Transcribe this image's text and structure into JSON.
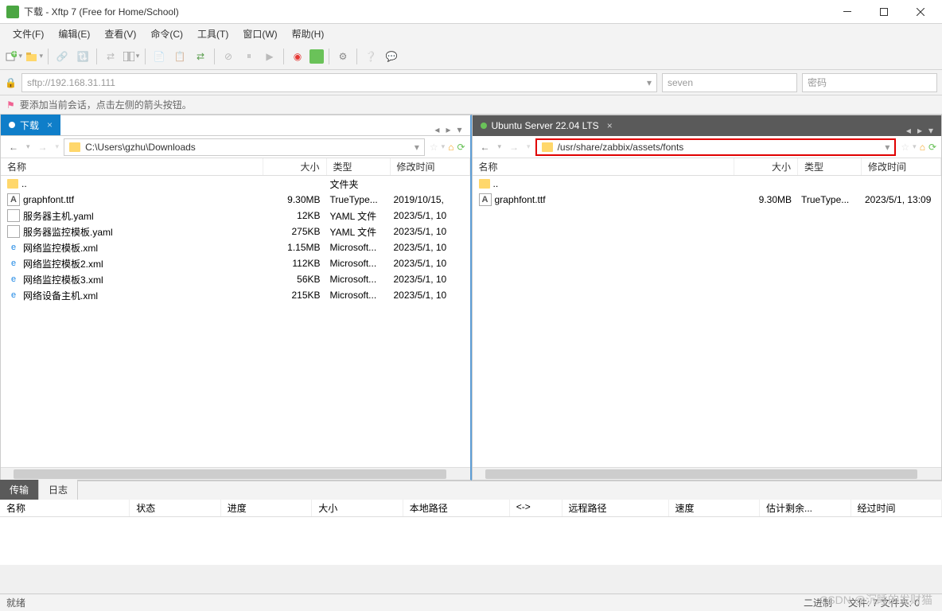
{
  "window": {
    "title": "下载 - Xftp 7 (Free for Home/School)"
  },
  "menu": {
    "file": "文件(F)",
    "edit": "编辑(E)",
    "view": "查看(V)",
    "cmd": "命令(C)",
    "tools": "工具(T)",
    "window": "窗口(W)",
    "help": "帮助(H)"
  },
  "address": {
    "url": "sftp://192.168.31.111",
    "user_ph": "seven",
    "pass_ph": "密码"
  },
  "hint": "要添加当前会话，点击左侧的箭头按钮。",
  "left": {
    "tab": "下载",
    "path": "C:\\Users\\gzhu\\Downloads",
    "cols": {
      "name": "名称",
      "size": "大小",
      "type": "类型",
      "date": "修改时间"
    },
    "parent": {
      "name": "..",
      "type": "文件夹"
    },
    "files": [
      {
        "ico": "font",
        "name": "graphfont.ttf",
        "size": "9.30MB",
        "type": "TrueType...",
        "date": "2019/10/15,"
      },
      {
        "ico": "yaml",
        "name": "服务器主机.yaml",
        "size": "12KB",
        "type": "YAML 文件",
        "date": "2023/5/1, 10"
      },
      {
        "ico": "yaml",
        "name": "服务器监控模板.yaml",
        "size": "275KB",
        "type": "YAML 文件",
        "date": "2023/5/1, 10"
      },
      {
        "ico": "xml",
        "name": "网络监控模板.xml",
        "size": "1.15MB",
        "type": "Microsoft...",
        "date": "2023/5/1, 10"
      },
      {
        "ico": "xml",
        "name": "网络监控模板2.xml",
        "size": "112KB",
        "type": "Microsoft...",
        "date": "2023/5/1, 10"
      },
      {
        "ico": "xml",
        "name": "网络监控模板3.xml",
        "size": "56KB",
        "type": "Microsoft...",
        "date": "2023/5/1, 10"
      },
      {
        "ico": "xml",
        "name": "网络设备主机.xml",
        "size": "215KB",
        "type": "Microsoft...",
        "date": "2023/5/1, 10"
      }
    ]
  },
  "right": {
    "tab": "Ubuntu Server 22.04 LTS",
    "path": "/usr/share/zabbix/assets/fonts",
    "cols": {
      "name": "名称",
      "size": "大小",
      "type": "类型",
      "date": "修改时间"
    },
    "parent": {
      "name": ".."
    },
    "files": [
      {
        "ico": "font",
        "name": "graphfont.ttf",
        "size": "9.30MB",
        "type": "TrueType...",
        "date": "2023/5/1, 13:09"
      }
    ]
  },
  "transfer": {
    "tab1": "传输",
    "tab2": "日志",
    "cols": {
      "name": "名称",
      "status": "状态",
      "progress": "进度",
      "size": "大小",
      "local": "本地路径",
      "dir": "<->",
      "remote": "远程路径",
      "speed": "速度",
      "remain": "估计剩余...",
      "elapsed": "经过时间"
    }
  },
  "status": {
    "ready": "就绪",
    "encoding": "二进制",
    "count": "文件: 7 文件夹: 0"
  },
  "watermark": "CSDN @沉睡的发财猫"
}
